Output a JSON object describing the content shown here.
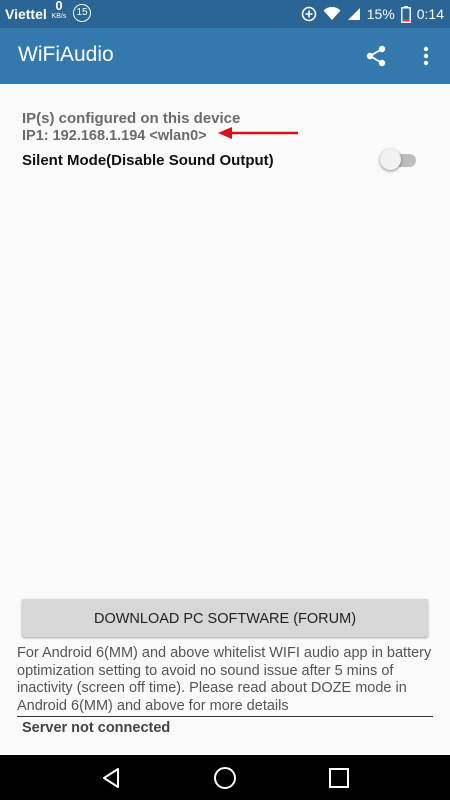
{
  "status_bar": {
    "carrier": "Viettel",
    "speed_value": "0",
    "speed_unit": "KB/s",
    "notification_count": "15",
    "battery_percent": "15%",
    "time": "0:14",
    "icons": [
      "data-saver-icon",
      "wifi-icon",
      "signal-icon",
      "battery-icon"
    ]
  },
  "app_bar": {
    "title": "WiFiAudio",
    "actions": [
      "share-icon",
      "more-vert-icon"
    ]
  },
  "ip_section": {
    "header": "IP(s) configured on this device",
    "ip1": "IP1: 192.168.1.194 <wlan0>",
    "arrow_color": "#d90f1a"
  },
  "silent_mode": {
    "label": "Silent Mode(Disable Sound Output)",
    "enabled": false
  },
  "download_button": {
    "label": "DOWNLOAD PC SOFTWARE (FORUM)"
  },
  "note": "For Android 6(MM) and above whitelist WIFI audio app in battery optimization setting to avoid no sound issue after 5 mins of inactivity (screen off time). Please read about DOZE mode in Android 6(MM) and above for more details",
  "server_status": "Server not connected",
  "nav_bar": {
    "buttons": [
      "back-icon",
      "home-icon",
      "recents-icon"
    ]
  },
  "colors": {
    "status_bar": "#2a6595",
    "app_bar": "#3479ad",
    "background": "#fafafa"
  }
}
